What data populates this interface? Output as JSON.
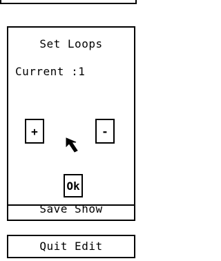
{
  "dialog": {
    "title": "Set Loops",
    "current_label": "Current :1",
    "plus_label": "+",
    "minus_label": "-",
    "ok_label": "Ok"
  },
  "menu": {
    "save_show_label": "Save Show",
    "quit_edit_label": "Quit Edit"
  },
  "cursor": {
    "icon": "arrow-pointer-icon"
  }
}
